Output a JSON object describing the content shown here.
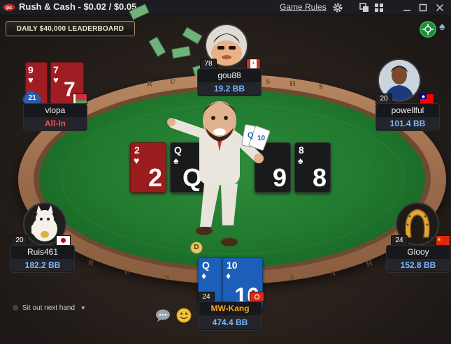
{
  "window": {
    "title": "Rush & Cash - $0.02 / $0.05",
    "game_rules": "Game Rules"
  },
  "banner": {
    "leaderboard": "DAILY $40,000 LEADERBOARD"
  },
  "table_text": [
    "R",
    "U",
    "S",
    "H",
    "$",
    "C",
    "A",
    "S",
    "H",
    "R",
    "U",
    "S",
    "$",
    "H"
  ],
  "community_cards": [
    {
      "rank": "2",
      "suit": "♥",
      "color": "red"
    },
    {
      "rank": "Q",
      "suit": "♠",
      "color": "black"
    },
    {
      "rank": "9",
      "suit": "",
      "color": "black"
    },
    {
      "rank": "8",
      "suit": "♠",
      "color": "black"
    }
  ],
  "players": {
    "gou88": {
      "name": "gou88",
      "stack": "19.2 BB",
      "level": "78"
    },
    "vlopa": {
      "name": "vlopa",
      "status": "All-In",
      "level": "21",
      "cards": [
        {
          "rank": "9",
          "suit": "♥"
        },
        {
          "rank": "7",
          "suit": "♥"
        }
      ]
    },
    "powellful": {
      "name": "powellful",
      "stack": "101.4 BB",
      "level": "20"
    },
    "ruis461": {
      "name": "Ruis461",
      "stack": "182.2 BB",
      "level": "20"
    },
    "glooy": {
      "name": "Glooy",
      "stack": "152.8 BB",
      "level": "24"
    },
    "hero": {
      "name": "MW-Kang",
      "stack": "474.4 BB",
      "level": "24",
      "cards": [
        {
          "rank": "Q",
          "suit": "♦"
        },
        {
          "rank": "10",
          "suit": "♦"
        }
      ]
    }
  },
  "dealer_button": "D",
  "sit_out": {
    "label": "Sit out next hand"
  },
  "colors": {
    "felt": "#217a2e",
    "rim": "#9a6b4a",
    "stack_blue": "#7cb8ff",
    "allin_red": "#ff4b4b",
    "hero_name": "#f5a623"
  }
}
